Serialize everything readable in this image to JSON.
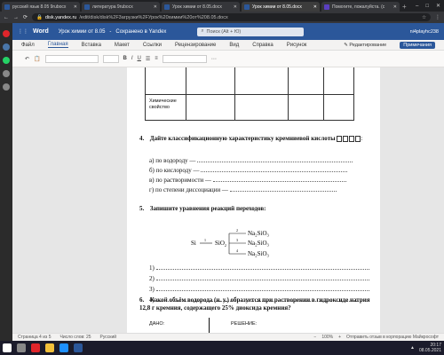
{
  "browser": {
    "tabs": [
      {
        "title": "русский язык 8.05 9rubocx",
        "color": "#2b579a",
        "active": false
      },
      {
        "title": "литература 9rubocx",
        "color": "#2b579a",
        "active": false
      },
      {
        "title": "Урок химии от 8.05.docx",
        "color": "#2b579a",
        "active": false
      },
      {
        "title": "Урок химии от 8.05.docx",
        "color": "#2b579a",
        "active": true
      },
      {
        "title": "Помогите, пожалуйста. (с",
        "color": "#5a3fc0",
        "active": false
      }
    ],
    "new_tab": "+",
    "window_controls": [
      "–",
      "□",
      "✕"
    ],
    "url_domain": "disk.yandex.ru",
    "url_path": "/edit/disk/disk%2F3агрузки%2FУрок%20химии%20от%208.05.docx"
  },
  "word": {
    "app_name": "Word",
    "doc_title": "Урок химии от 8.05",
    "save_status": "Сохранено в Yandex",
    "search_placeholder": "Поиск (Alt + Ю)",
    "user": "ni4playhc238",
    "menu": [
      "Файл",
      "Главная",
      "Вставка",
      "Макет",
      "Ссылки",
      "Рецензирование",
      "Вид",
      "Справка",
      "Рисунок"
    ],
    "active_menu": "Главная",
    "edit_mode": "Редактирование",
    "share": "Примечания"
  },
  "document": {
    "table_label": "Химические свойство",
    "q4_number": "4.",
    "q4_text": "Дайте классификационную характеристику кремниевой кислоты",
    "q4_items": [
      "а) по водороду —",
      "б) по кислороду —",
      "в) по растворимости —",
      "г) по степени диссоциации —"
    ],
    "q5_number": "5.",
    "q5_text": "Запишите уравнения реакций переходов:",
    "scheme": {
      "si": "Si",
      "sio2": "SiO",
      "p1": "Na₂SiO₃",
      "p2": "Na₂SiO₃",
      "p3": "Na₂SiO₃",
      "n1": "1",
      "n2": "2",
      "n3": "3",
      "n4": "4"
    },
    "answers": [
      "1)",
      "2)",
      "3)",
      "4)"
    ],
    "q6_number": "6.",
    "q6_text": "Какой объём водорода (н. у.) образуется при растворении в гидроксиде натрия 12,8 г кремния, содержащего 25% диоксида кремния?",
    "dano": "ДАНО:",
    "reshenie": "РЕШЕНИЕ:"
  },
  "status": {
    "page": "Страница 4 из 5",
    "words": "Число слов: 25",
    "lang": "Русский",
    "zoom": "100%",
    "feedback": "Отправить отзыв в корпорацию Майкрософт"
  },
  "taskbar": {
    "time": "20:17",
    "date": "08.05.2021",
    "icons": [
      {
        "name": "start",
        "color": "#ffffff"
      },
      {
        "name": "search",
        "color": "#888888"
      },
      {
        "name": "opera",
        "color": "#e0252b"
      },
      {
        "name": "explorer",
        "color": "#f3c03a"
      },
      {
        "name": "edge",
        "color": "#1e90ff"
      },
      {
        "name": "word",
        "color": "#2b579a"
      }
    ]
  }
}
